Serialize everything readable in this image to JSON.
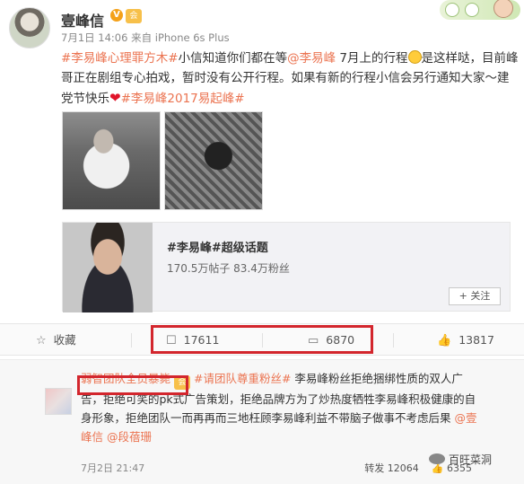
{
  "post": {
    "username": "壹峰信",
    "verified_badge": "V",
    "vip_badge": "会",
    "timestamp": "7月1日 14:06",
    "source_prefix": "来自",
    "source_device": "iPhone 6s Plus",
    "content": {
      "tag1": "#李易峰心理罪方木#",
      "text1": "小信知道你们都在等",
      "mention1": "@李易峰",
      "text2": " 7月上的行程",
      "text3": "是这样哒，目前峰哥正在剧组专心拍戏，暂时没有公开行程。如果有新的行程小信会另行通知大家～建党节快乐",
      "heart": "❤",
      "tag2": "#李易峰2017易起峰#"
    },
    "topic_card": {
      "title": "#李易峰#超级话题",
      "stats": "170.5万帖子 83.4万粉丝",
      "follow_label": "+ 关注"
    }
  },
  "actions": {
    "collect_label": "收藏",
    "repost_count": "17611",
    "comment_count": "6870",
    "like_count": "13817",
    "icons": {
      "collect": "star-icon",
      "repost": "repost-icon",
      "comment": "comment-icon",
      "like": "thumb-up-icon"
    }
  },
  "comment": {
    "username": "弱智团队全员暴毙",
    "vip_badge": "会",
    "tag": "#请团队尊重粉丝#",
    "text": "李易峰粉丝拒绝捆绑性质的双人广告，拒绝可笑的pk式广告策划，拒绝品牌方为了炒热度牺牲李易峰积极健康的自身形象，拒绝团队一而再再而三地枉顾李易峰利益不带脑子做事不考虑后果",
    "mention1": "@壹峰信",
    "mention2": "@段蓓珊",
    "time": "7月2日 21:47",
    "repost_label": "转发 12064",
    "like_label": "6355"
  },
  "watermark": {
    "text": "百旺菜洞"
  },
  "colors": {
    "accent": "#eb7350",
    "highlight_box": "#d3262d"
  }
}
